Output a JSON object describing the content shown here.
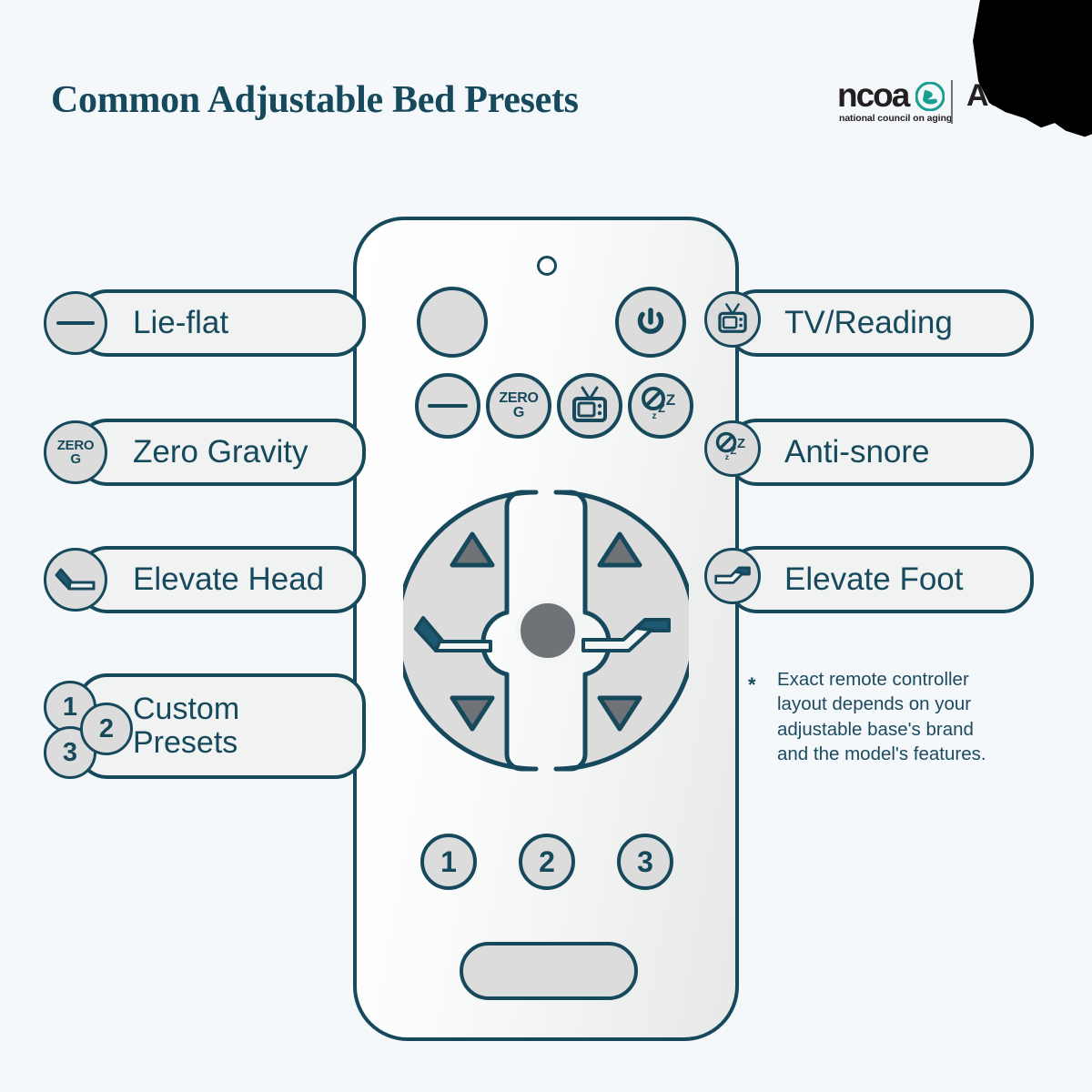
{
  "header": {
    "title": "Common Adjustable Bed Presets"
  },
  "logo": {
    "wordmark": "ncoa",
    "tagline": "national council on aging",
    "secondary": "Adv",
    "accent_color": "#1a9e91",
    "text_color": "#231f20"
  },
  "theme": {
    "background": "#f4f8fb",
    "ink": "#17495c",
    "pill_fill": "#f1f2f2",
    "button_fill": "#dcdcdc",
    "remote_body": "#fbfcfc",
    "arrow_fill": "#6f7377",
    "center_knob": "#6f7377"
  },
  "left_labels": [
    {
      "id": "lie-flat",
      "text": "Lie-flat",
      "icon": "flat-line-icon"
    },
    {
      "id": "zero-gravity",
      "text": "Zero Gravity",
      "icon": "zero-g-icon",
      "icon_top": "ZERO",
      "icon_bottom": "G"
    },
    {
      "id": "elevate-head",
      "text": "Elevate Head",
      "icon": "elevate-head-icon"
    },
    {
      "id": "custom-presets",
      "text": "Custom\nPresets",
      "icon": "preset-numbers-icon",
      "numbers": [
        "1",
        "2",
        "3"
      ]
    }
  ],
  "right_labels": [
    {
      "id": "tv-reading",
      "text": "TV/Reading",
      "icon": "tv-icon"
    },
    {
      "id": "anti-snore",
      "text": "Anti-snore",
      "icon": "anti-snore-icon"
    },
    {
      "id": "elevate-foot",
      "text": "Elevate Foot",
      "icon": "elevate-foot-icon"
    }
  ],
  "footnote": {
    "marker": "*",
    "text": "Exact remote controller\nlayout depends on your\nadjustable base's brand\nand the model's features."
  },
  "remote": {
    "led_indicator": "led-indicator",
    "top_buttons": [
      {
        "id": "blank-button",
        "icon": "blank-round-button"
      },
      {
        "id": "power-button",
        "icon": "power-icon"
      }
    ],
    "preset_row": [
      {
        "id": "flat-button",
        "icon": "flat-line-icon"
      },
      {
        "id": "zero-g-button",
        "icon": "zero-g-icon",
        "icon_top": "ZERO",
        "icon_bottom": "G"
      },
      {
        "id": "tv-button",
        "icon": "tv-icon"
      },
      {
        "id": "anti-snore-button",
        "icon": "anti-snore-icon"
      }
    ],
    "dpad": {
      "left_pad": {
        "up": "head-up-arrow",
        "down": "head-down-arrow",
        "center_icon": "elevate-head-icon"
      },
      "right_pad": {
        "up": "foot-up-arrow",
        "down": "foot-down-arrow",
        "center_icon": "elevate-foot-icon"
      },
      "center": "center-knob"
    },
    "memory_buttons": [
      "1",
      "2",
      "3"
    ],
    "bottom_button": "wide-pill-button"
  }
}
